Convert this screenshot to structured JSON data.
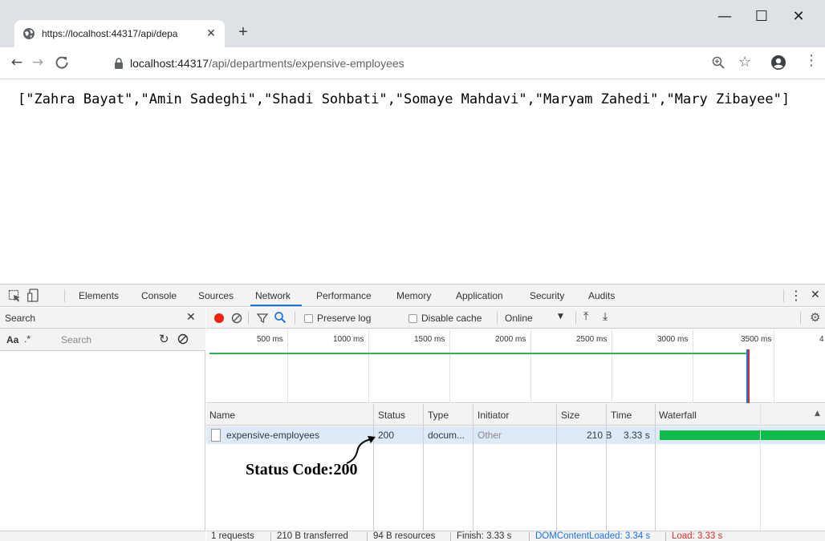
{
  "browser": {
    "tab_title": "https://localhost:44317/api/depa",
    "tab_close": "✕",
    "new_tab": "+",
    "window_controls": {
      "minimize": "—",
      "maximize": "☐",
      "close": "✕"
    },
    "url_host": "localhost:44317",
    "url_path": "/api/departments/expensive-employees",
    "icons": [
      "favicon-globe-icon",
      "back-arrow-icon",
      "forward-arrow-icon",
      "reload-icon",
      "lock-icon",
      "zoom-icon",
      "star-icon",
      "profile-icon",
      "menu-icon"
    ]
  },
  "page": {
    "json_text": "[\"Zahra Bayat\",\"Amin Sadeghi\",\"Shadi Sohbati\",\"Somaye Mahdavi\",\"Maryam Zahedi\",\"Mary Zibayee\"]"
  },
  "devtools": {
    "tabs": [
      "Elements",
      "Console",
      "Sources",
      "Network",
      "Performance",
      "Memory",
      "Application",
      "Security",
      "Audits"
    ],
    "active_tab": "Network",
    "search_pane": {
      "title": "Search",
      "case_toggle": "Aa",
      "regex_toggle": ".*",
      "placeholder": "Search"
    },
    "network_toolbar": {
      "preserve_log": "Preserve log",
      "disable_cache": "Disable cache",
      "throttling": "Online"
    },
    "overview_ticks": [
      "500 ms",
      "1000 ms",
      "1500 ms",
      "2000 ms",
      "2500 ms",
      "3000 ms",
      "3500 ms",
      "4"
    ],
    "columns": [
      "Name",
      "Status",
      "Type",
      "Initiator",
      "Size",
      "Time",
      "Waterfall"
    ],
    "rows": [
      {
        "name": "expensive-employees",
        "status": "200",
        "type": "docum...",
        "initiator": "Other",
        "size": "210 B",
        "time": "3.33 s"
      }
    ],
    "status_bar": {
      "requests": "1 requests",
      "transferred": "210 B transferred",
      "resources": "94 B resources",
      "finish": "Finish: 3.33 s",
      "dom_content_loaded": "DOMContentLoaded: 3.34 s",
      "load": "Load: 3.33 s"
    },
    "colors": {
      "accent": "#1a73e8",
      "record": "#ee2211",
      "waterfall": "#0cbc4b",
      "load": "#d93025",
      "selected_row": "#dfeaf8"
    }
  },
  "annotation": {
    "text": "Status Code:200"
  }
}
